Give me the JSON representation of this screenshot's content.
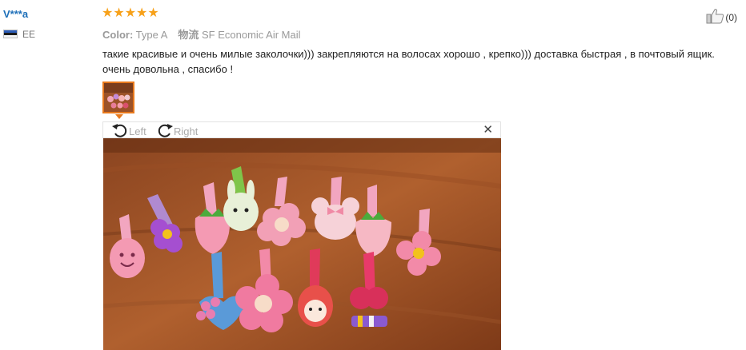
{
  "reviewer": {
    "name": "V***a",
    "country": "EE"
  },
  "rating": {
    "stars": "★★★★★",
    "value": 5
  },
  "meta": {
    "color_label": "Color:",
    "color_value": "Type A",
    "shipping_label": "物流",
    "shipping_value": "SF Economic Air Mail"
  },
  "review": {
    "text": "такие красивые и очень милые заколочки))) закрепляются на волосах хорошо , крепко))) доставка быстрая , в почтовый ящик. очень довольна , спасибо !"
  },
  "helpful": {
    "count": "(0)"
  },
  "viewer": {
    "rotate_left": "Left",
    "rotate_right": "Right",
    "close": "✕"
  },
  "colors": {
    "username": "#1d6fb8",
    "star": "#f7a11a",
    "thumb_border": "#e8791c",
    "table": "#a4552a"
  }
}
